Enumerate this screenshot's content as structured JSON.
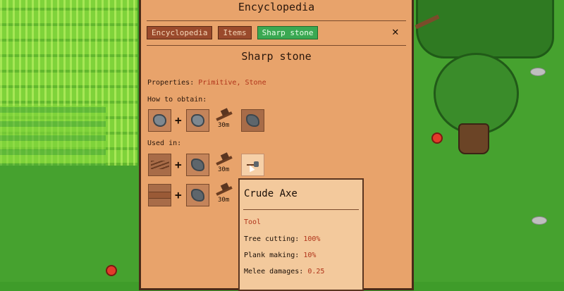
{
  "window": {
    "title": "Encyclopedia",
    "breadcrumbs": [
      "Encyclopedia",
      "Items",
      "Sharp stone"
    ],
    "close_label": "✕"
  },
  "item": {
    "name": "Sharp stone",
    "properties_label": "Properties:",
    "properties_value": "Primitive, Stone",
    "obtain_label": "How to obtain:",
    "used_in_label": "Used in:"
  },
  "recipes": {
    "obtain": {
      "time": "30m",
      "inputs": [
        "stone-icon",
        "stone-icon"
      ],
      "tool": "hammer-icon",
      "output": "sharp-stone-icon"
    },
    "used_in": [
      {
        "time": "30m",
        "inputs": [
          "sticks-icon",
          "sharp-stone-icon"
        ],
        "tool": "hammer-icon",
        "output": "crude-axe-icon"
      },
      {
        "time": "30m",
        "inputs": [
          "plank-icon",
          "sharp-stone-icon"
        ],
        "tool": "hammer-icon",
        "output": ""
      }
    ]
  },
  "plus_symbol": "+",
  "tooltip": {
    "title": "Crude Axe",
    "category": "Tool",
    "stats": [
      {
        "label": "Tree cutting:",
        "value": "100%"
      },
      {
        "label": "Plank making:",
        "value": "10%"
      },
      {
        "label": "Melee damages:",
        "value": "0.25"
      }
    ]
  },
  "colors": {
    "panel_bg": "#e8a36b",
    "crumb_bg": "#9a4a2c",
    "crumb_active_bg": "#3aa852",
    "accent_text": "#b0341a",
    "tooltip_bg": "#f3c99c"
  }
}
